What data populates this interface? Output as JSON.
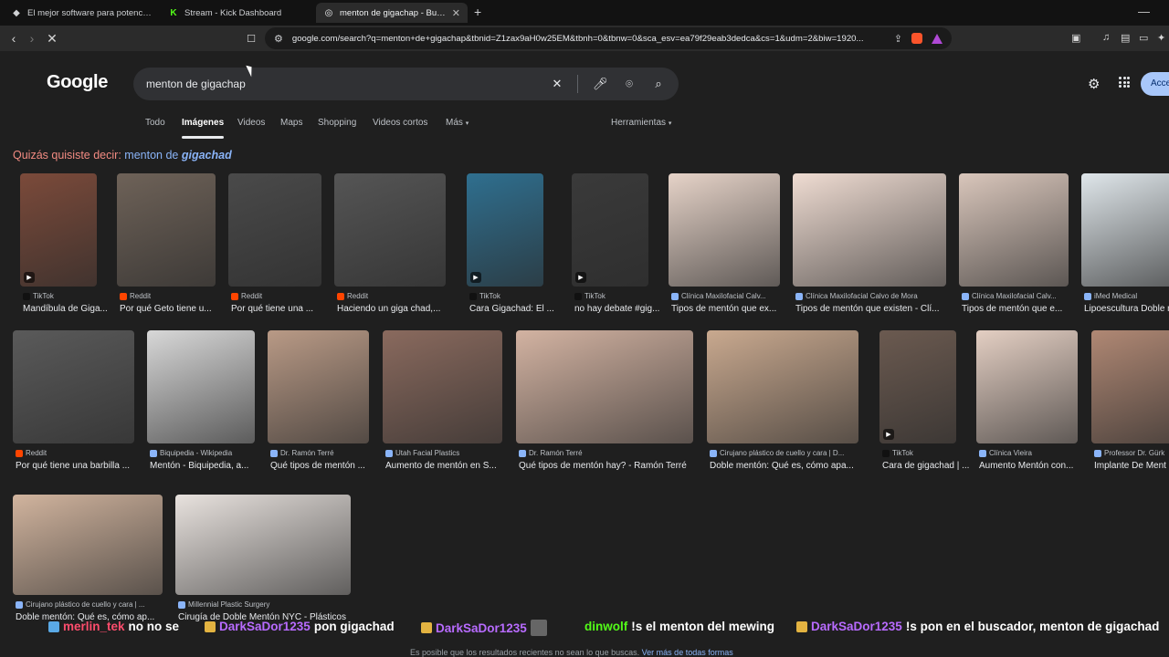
{
  "browser": {
    "tabs": [
      {
        "title": "El mejor software para potenciar tu s",
        "active": false
      },
      {
        "title": "Stream - Kick Dashboard",
        "active": false
      },
      {
        "title": "menton de gigachap - Buscar co",
        "active": true
      }
    ],
    "new_tab_glyph": "+",
    "url": "google.com/search?q=menton+de+gigachap&tbnid=Z1zax9aH0w25EM&tbnh=0&tbnw=0&sca_esv=ea79f29eab3dedca&cs=1&udm=2&biw=1920..."
  },
  "google": {
    "logo": "Google",
    "query": "menton de gigachap",
    "signin_label": "Acceder",
    "tabs": [
      "Todo",
      "Imágenes",
      "Videos",
      "Maps",
      "Shopping",
      "Videos cortos",
      "Más"
    ],
    "tools_label": "Herramientas",
    "did_you_mean": {
      "label": "Quizás quisiste decir:",
      "prefix": "menton de",
      "suggestion": "gigachad"
    }
  },
  "images": [
    {
      "source": "TikTok",
      "caption": "Mandíbula de Giga...",
      "color": "#7b4a3a",
      "video": true
    },
    {
      "source": "Reddit",
      "caption": "Por qué Geto tiene u...",
      "color": "#6e6258"
    },
    {
      "source": "Reddit",
      "caption": "Por qué tiene una ...",
      "color": "#4a4a4a"
    },
    {
      "source": "Reddit",
      "caption": "Haciendo un giga chad,...",
      "color": "#555555"
    },
    {
      "source": "TikTok",
      "caption": "Cara Gigachad: El ...",
      "color": "#2f6f8f",
      "video": true
    },
    {
      "source": "TikTok",
      "caption": "no hay debate #gig...",
      "color": "#3a3a3a",
      "video": true
    },
    {
      "source": "Clínica Maxilofacial Calv...",
      "caption": "Tipos de mentón que ex...",
      "color": "#e6d3c8"
    },
    {
      "source": "Clínica Maxilofacial Calvo de Mora",
      "caption": "Tipos de mentón que existen - Clí...",
      "color": "#efdcd2"
    },
    {
      "source": "Clínica Maxilofacial Calv...",
      "caption": "Tipos de mentón que e...",
      "color": "#d9c6bb"
    },
    {
      "source": "iMed Medical",
      "caption": "Lipoescultura Doble m",
      "color": "#dfe6ea"
    },
    {
      "source": "Reddit",
      "caption": "Por qué tiene una barbilla ...",
      "color": "#5a5a5a"
    },
    {
      "source": "Biquipedia - Wikipedia",
      "caption": "Mentón - Biquipedia, a...",
      "color": "#d8d8d8"
    },
    {
      "source": "Dr. Ramón Terré",
      "caption": "Qué tipos de mentón ...",
      "color": "#b99a86"
    },
    {
      "source": "Utah Facial Plastics",
      "caption": "Aumento de mentón en S...",
      "color": "#8a6a5e"
    },
    {
      "source": "Dr. Ramón Terré",
      "caption": "Qué tipos de mentón hay? - Ramón Terré",
      "color": "#d3b3a2"
    },
    {
      "source": "Cirujano plástico de cuello y cara | D...",
      "caption": "Doble mentón: Qué es, cómo apa...",
      "color": "#c9a98f"
    },
    {
      "source": "TikTok",
      "caption": "Cara de gigachad | ...",
      "color": "#6b5a50",
      "video": true
    },
    {
      "source": "Clínica Vieira",
      "caption": "Aumento Mentón con...",
      "color": "#e4cfc3"
    },
    {
      "source": "Professor Dr. Gürk",
      "caption": "Implante De Ment",
      "color": "#b08874"
    },
    {
      "source": "Cirujano plástico de cuello y cara | ...",
      "caption": "Doble mentón: Qué es, cómo ap...",
      "color": "#d1b49e"
    },
    {
      "source": "Millennial Plastic Surgery",
      "caption": "Cirugía de Doble Mentón NYC - Plásticos",
      "color": "#e8e2de"
    }
  ],
  "chat": [
    {
      "user": "merlin_tek",
      "text": "no no se",
      "badge": "square",
      "user_color": "#ff4d6d"
    },
    {
      "user": "DarkSaDor1235",
      "text": "pon gigachad",
      "badge": "crown",
      "user_color": "#b86bff"
    },
    {
      "user": "DarkSaDor1235",
      "text": "",
      "badge": "crown",
      "user_color": "#b86bff",
      "emote": true
    },
    {
      "user": "dinwolf",
      "text": "!s el menton del mewing",
      "badge": "none",
      "user_color": "#53fc18"
    },
    {
      "user": "DarkSaDor1235",
      "text": "!s pon en el buscador, menton de gigachad",
      "badge": "crown",
      "user_color": "#b86bff"
    }
  ],
  "footer": {
    "text": "Es posible que los resultados recientes no sean lo que buscas.",
    "link": "Ver más de todas formas"
  },
  "colors": {
    "background": "#1f1f1f",
    "link": "#8ab4f8",
    "accent": "#a8c7fa"
  }
}
